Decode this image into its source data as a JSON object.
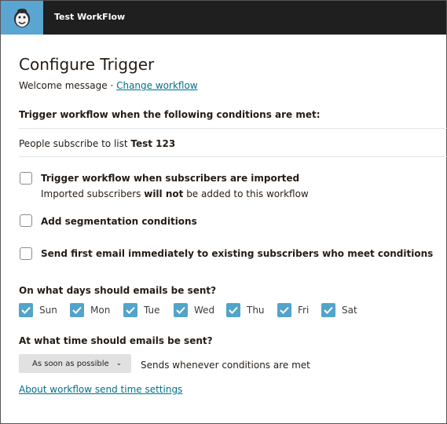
{
  "topbar": {
    "title": "Test WorkFlow",
    "logo_icon": "freddie-logo-icon",
    "accent_color": "#5aa5d2",
    "bar_color": "#1f1f1f"
  },
  "page": {
    "title": "Configure Trigger",
    "workflow_type": "Welcome message",
    "separator": " · ",
    "change_link": "Change workflow"
  },
  "conditions": {
    "heading": "Trigger workflow when the following conditions are met:",
    "list_prefix": "People subscribe to list ",
    "list_name": "Test 123"
  },
  "options": {
    "imported": {
      "label": "Trigger workflow when subscribers are imported",
      "sub_prefix": "Imported subscribers ",
      "sub_bold": "will not",
      "sub_suffix": " be added to this workflow",
      "checked": false
    },
    "segmentation": {
      "label": "Add segmentation conditions",
      "checked": false
    },
    "send_existing": {
      "label": "Send first email immediately to existing subscribers who meet conditions",
      "checked": false
    }
  },
  "days": {
    "question": "On what days should emails be sent?",
    "items": [
      {
        "label": "Sun",
        "checked": true
      },
      {
        "label": "Mon",
        "checked": true
      },
      {
        "label": "Tue",
        "checked": true
      },
      {
        "label": "Wed",
        "checked": true
      },
      {
        "label": "Thu",
        "checked": true
      },
      {
        "label": "Fri",
        "checked": true
      },
      {
        "label": "Sat",
        "checked": true
      }
    ]
  },
  "time": {
    "question": "At what time should emails be sent?",
    "selected": "As soon as possible",
    "description": "Sends whenever conditions are met",
    "settings_link": "About workflow send time settings"
  },
  "colors": {
    "link": "#00708b",
    "checkbox_checked": "#52a4c8"
  }
}
